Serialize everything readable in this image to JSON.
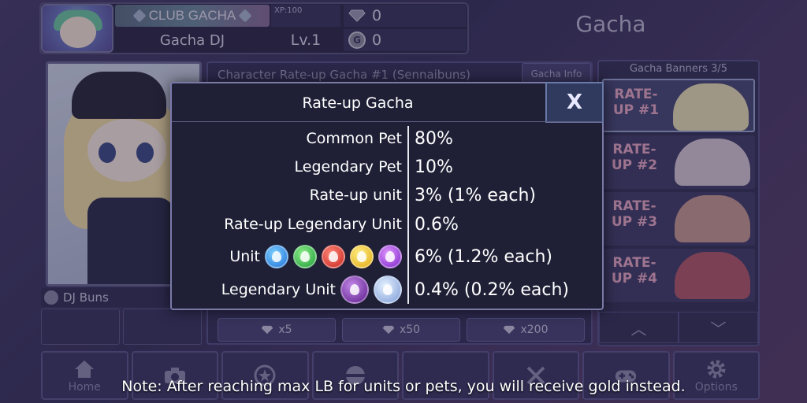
{
  "header": {
    "club_label": "CLUB GACHA",
    "player_name": "Gacha DJ",
    "xp_label": "XP:100",
    "level_label": "Lv.1",
    "gems_count": "0",
    "gold_count": "0",
    "gold_icon_letter": "G",
    "screen_title": "Gacha"
  },
  "character": {
    "name": "DJ Buns"
  },
  "banner": {
    "title": "Character Rate-up Gacha #1 (Sennaibuns)",
    "info_label": "Gacha Info",
    "pull_buttons": [
      {
        "cost": "x5"
      },
      {
        "cost": "x50"
      },
      {
        "cost": "x200"
      }
    ]
  },
  "banner_list": {
    "title": "Gacha Banners 3/5",
    "items": [
      {
        "label": "RATE-UP #1",
        "color": "#e8a9c7"
      },
      {
        "label": "RATE-UP #2",
        "color": "#e8a9c7"
      },
      {
        "label": "RATE-UP #3",
        "color": "#e8a9c7"
      },
      {
        "label": "RATE-UP #4",
        "color": "#e8a9c7"
      }
    ]
  },
  "nav": {
    "items": [
      {
        "label": "Home",
        "icon": "house-icon"
      },
      {
        "label": "",
        "icon": "camera-icon"
      },
      {
        "label": "",
        "icon": "star-circle-icon"
      },
      {
        "label": "",
        "icon": "ball-icon"
      },
      {
        "label": "",
        "icon": "gift-icon"
      },
      {
        "label": "",
        "icon": "crossed-swords-icon"
      },
      {
        "label": "",
        "icon": "gamepad-icon"
      },
      {
        "label": "Options",
        "icon": "gear-icon"
      }
    ]
  },
  "modal": {
    "title": "Rate-up Gacha",
    "close_label": "X",
    "rows": [
      {
        "label": "Common Pet",
        "value": "80%"
      },
      {
        "label": "Legendary Pet",
        "value": "10%"
      },
      {
        "label": "Rate-up unit",
        "value": "3% (1% each)"
      },
      {
        "label": "Rate-up Legendary Unit",
        "value": "0.6%"
      },
      {
        "label": "Unit",
        "value": "6% (1.2% each)"
      },
      {
        "label": "Legendary Unit",
        "value": "0.4% (0.2% each)"
      }
    ],
    "unit_orbs": [
      "water-orb-icon",
      "wind-orb-icon",
      "fire-orb-icon",
      "light-orb-icon",
      "dark-orb-icon"
    ],
    "legendary_orbs": [
      "legendary-dark-orb-icon",
      "legendary-light-orb-icon"
    ]
  },
  "note": "Note: After reaching max LB for units or pets, you will receive gold instead."
}
